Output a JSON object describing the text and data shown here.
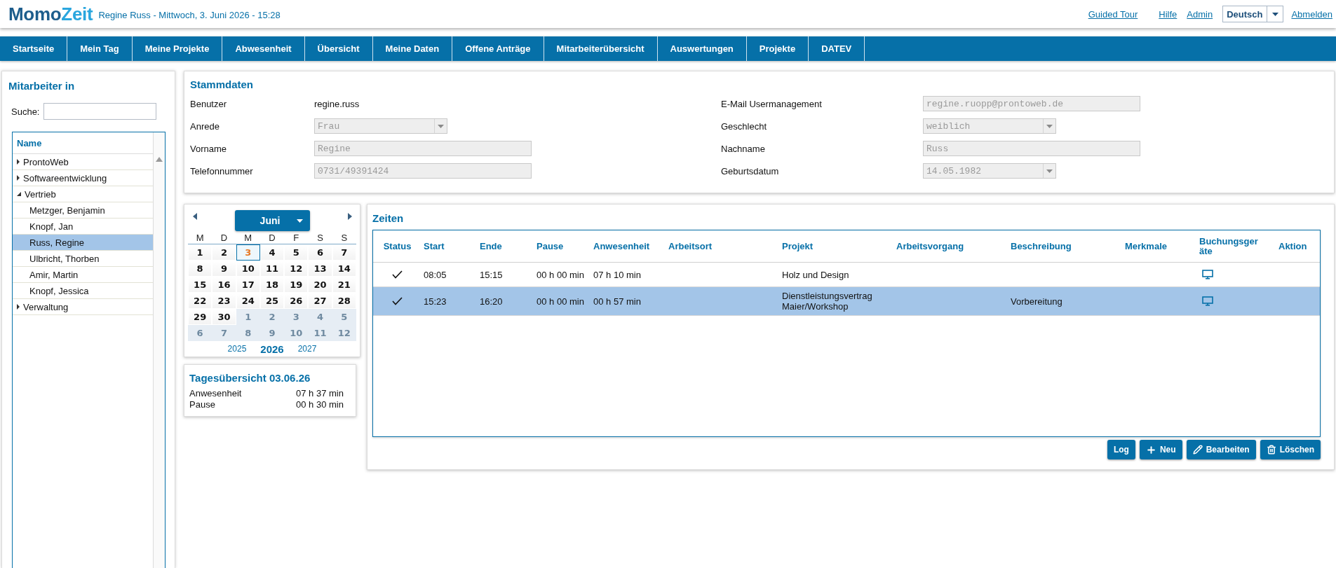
{
  "header": {
    "logo": {
      "primary": "Momo",
      "secondary": "Zeit"
    },
    "subtitle": "Regine Russ - Mittwoch, 3. Juni 2026 - 15:28",
    "links": [
      "Guided Tour",
      "Hilfe",
      "Admin"
    ],
    "language": "Deutsch",
    "logout": "Abmelden"
  },
  "nav": [
    {
      "label": "Startseite",
      "selected": false
    },
    {
      "label": "Mein Tag",
      "selected": false
    },
    {
      "label": "Meine Projekte",
      "selected": false
    },
    {
      "label": "Abwesenheit",
      "selected": false
    },
    {
      "label": "Übersicht",
      "selected": false
    },
    {
      "label": "Meine Daten",
      "selected": false
    },
    {
      "label": "Offene Anträge",
      "selected": false
    },
    {
      "label": "Mitarbeiterübersicht",
      "selected": false
    },
    {
      "label": "Auswertungen",
      "selected": false
    },
    {
      "label": "Projekte",
      "selected": false
    },
    {
      "label": "DATEV",
      "selected": false
    }
  ],
  "employees": {
    "title": "Mitarbeiter in",
    "search_label": "Suche:",
    "tree": {
      "column": "Name",
      "items": [
        {
          "label": "ProntoWeb",
          "expanded": false,
          "selected": false
        },
        {
          "label": "Softwareentwicklung",
          "expanded": false,
          "selected": false
        },
        {
          "label": "Vertrieb",
          "expanded": true,
          "selected": false,
          "children": [
            {
              "label": "Metzger, Benjamin",
              "selected": false
            },
            {
              "label": "Knopf, Jan",
              "selected": false
            },
            {
              "label": "Russ, Regine",
              "selected": true
            },
            {
              "label": "Ulbricht, Thorben",
              "selected": false
            },
            {
              "label": "Amir, Martin",
              "selected": false
            },
            {
              "label": "Knopf, Jessica",
              "selected": false
            }
          ]
        },
        {
          "label": "Verwaltung",
          "expanded": false,
          "selected": false
        }
      ]
    }
  },
  "master_data": {
    "title": "Stammdaten",
    "fields": [
      {
        "label": "Benutzer",
        "kind": "text",
        "value": "regine.russ"
      },
      {
        "label": "E-Mail Usermanagement",
        "kind": "input",
        "value": "regine.ruopp@prontoweb.de",
        "disabled": true
      },
      {
        "label": "Anrede",
        "kind": "select",
        "value": "Frau",
        "disabled": true
      },
      {
        "label": "Geschlecht",
        "kind": "select",
        "value": "weiblich",
        "disabled": true
      },
      {
        "label": "Vorname",
        "kind": "input",
        "value": "Regine",
        "disabled": true
      },
      {
        "label": "Nachname",
        "kind": "input",
        "value": "Russ",
        "disabled": true
      },
      {
        "label": "Telefonnummer",
        "kind": "input",
        "value": "0731/49391424",
        "disabled": true
      },
      {
        "label": "Geburtsdatum",
        "kind": "select",
        "value": "14.05.1982",
        "disabled": true
      }
    ]
  },
  "calendar": {
    "month": "Juni",
    "weekdays": [
      "M",
      "D",
      "M",
      "D",
      "F",
      "S",
      "S"
    ],
    "days": [
      {
        "label": "1",
        "outside": false,
        "selected": false
      },
      {
        "label": "2",
        "outside": false,
        "selected": false
      },
      {
        "label": "3",
        "outside": false,
        "selected": true
      },
      {
        "label": "4",
        "outside": false,
        "selected": false
      },
      {
        "label": "5",
        "outside": false,
        "selected": false
      },
      {
        "label": "6",
        "outside": false,
        "selected": false
      },
      {
        "label": "7",
        "outside": false,
        "selected": false
      },
      {
        "label": "8",
        "outside": false,
        "selected": false
      },
      {
        "label": "9",
        "outside": false,
        "selected": false
      },
      {
        "label": "10",
        "outside": false,
        "selected": false
      },
      {
        "label": "11",
        "outside": false,
        "selected": false
      },
      {
        "label": "12",
        "outside": false,
        "selected": false
      },
      {
        "label": "13",
        "outside": false,
        "selected": false
      },
      {
        "label": "14",
        "outside": false,
        "selected": false
      },
      {
        "label": "15",
        "outside": false,
        "selected": false
      },
      {
        "label": "16",
        "outside": false,
        "selected": false
      },
      {
        "label": "17",
        "outside": false,
        "selected": false
      },
      {
        "label": "18",
        "outside": false,
        "selected": false
      },
      {
        "label": "19",
        "outside": false,
        "selected": false
      },
      {
        "label": "20",
        "outside": false,
        "selected": false
      },
      {
        "label": "21",
        "outside": false,
        "selected": false
      },
      {
        "label": "22",
        "outside": false,
        "selected": false
      },
      {
        "label": "23",
        "outside": false,
        "selected": false
      },
      {
        "label": "24",
        "outside": false,
        "selected": false
      },
      {
        "label": "25",
        "outside": false,
        "selected": false
      },
      {
        "label": "26",
        "outside": false,
        "selected": false
      },
      {
        "label": "27",
        "outside": false,
        "selected": false
      },
      {
        "label": "28",
        "outside": false,
        "selected": false
      },
      {
        "label": "29",
        "outside": false,
        "selected": false
      },
      {
        "label": "30",
        "outside": false,
        "selected": false
      },
      {
        "label": "1",
        "outside": true,
        "selected": false
      },
      {
        "label": "2",
        "outside": true,
        "selected": false
      },
      {
        "label": "3",
        "outside": true,
        "selected": false
      },
      {
        "label": "4",
        "outside": true,
        "selected": false
      },
      {
        "label": "5",
        "outside": true,
        "selected": false
      },
      {
        "label": "6",
        "outside": true,
        "selected": false
      },
      {
        "label": "7",
        "outside": true,
        "selected": false
      },
      {
        "label": "8",
        "outside": true,
        "selected": false
      },
      {
        "label": "9",
        "outside": true,
        "selected": false
      },
      {
        "label": "10",
        "outside": true,
        "selected": false
      },
      {
        "label": "11",
        "outside": true,
        "selected": false
      },
      {
        "label": "12",
        "outside": true,
        "selected": false
      }
    ],
    "years": [
      {
        "label": "2025",
        "selected": false
      },
      {
        "label": "2026",
        "selected": true
      },
      {
        "label": "2027",
        "selected": false
      }
    ]
  },
  "day_overview": {
    "title": "Tagesübersicht 03.06.26",
    "rows": [
      {
        "label": "Anwesenheit",
        "value": "07 h 37 min"
      },
      {
        "label": "Pause",
        "value": "00 h 30 min"
      }
    ]
  },
  "times": {
    "title": "Zeiten",
    "columns": [
      "Status",
      "Start",
      "Ende",
      "Pause",
      "Anwesenheit",
      "Arbeitsort",
      "Projekt",
      "Arbeitsvorgang",
      "Beschreibung",
      "Merkmale",
      "Buchungsgeräte",
      "Aktion"
    ],
    "rows": [
      {
        "confirmed": true,
        "selected": false,
        "start": "08:05",
        "end": "15:15",
        "pause": "00 h 00 min",
        "presence": "07 h 10 min",
        "project": "Holz und Design"
      },
      {
        "confirmed": true,
        "selected": true,
        "start": "15:23",
        "end": "16:20",
        "pause": "00 h 00 min",
        "presence": "00 h 57 min",
        "project": "Dienstleistungsvertrag Maier/Workshop",
        "description": "Vorbereitung"
      }
    ],
    "buttons": [
      {
        "label": "Log",
        "kind": "plain"
      },
      {
        "label": "Neu",
        "kind": "add"
      },
      {
        "label": "Bearbeiten",
        "kind": "edit"
      },
      {
        "label": "Löschen",
        "kind": "delete"
      }
    ]
  }
}
